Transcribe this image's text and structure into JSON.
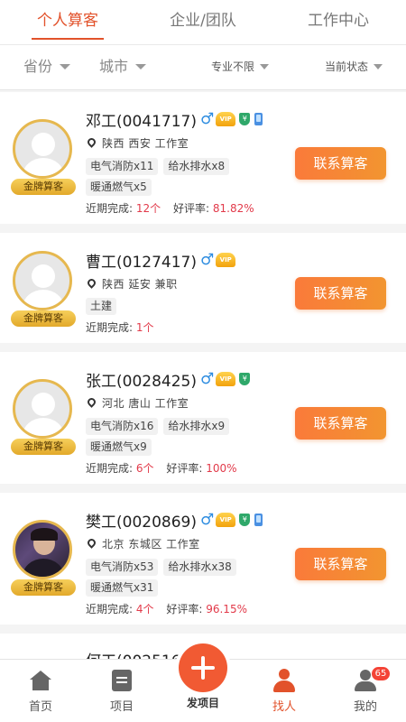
{
  "tabs": [
    {
      "label": "个人算客",
      "active": true
    },
    {
      "label": "企业/团队",
      "active": false
    },
    {
      "label": "工作中心",
      "active": false
    }
  ],
  "filters": {
    "province": "省份",
    "city": "城市",
    "specialty": "专业不限",
    "status": "当前状态"
  },
  "card_common": {
    "badge": "金牌算客",
    "contact": "联系算客",
    "recent_label": "近期完成:",
    "rating_label": "好评率:",
    "male_symbol": "♂",
    "vip_text": "VIP",
    "shield_text": "¥"
  },
  "workers": [
    {
      "name": "邓工(0041717)",
      "location": "陕西 西安 工作室",
      "tags": [
        "电气消防x11",
        "给水排水x8",
        "暖通燃气x5"
      ],
      "recent": "12个",
      "rating": "81.82%",
      "icons": [
        "male-icon",
        "vip-icon",
        "shield-icon",
        "phone-icon"
      ]
    },
    {
      "name": "曹工(0127417)",
      "location": "陕西 延安 兼职",
      "tags": [
        "土建"
      ],
      "recent": "1个",
      "icons": [
        "male-icon",
        "vip-icon"
      ]
    },
    {
      "name": "张工(0028425)",
      "location": "河北 唐山 工作室",
      "tags": [
        "电气消防x16",
        "给水排水x9",
        "暖通燃气x9"
      ],
      "recent": "6个",
      "rating": "100%",
      "icons": [
        "male-icon",
        "vip-icon",
        "shield-icon"
      ]
    },
    {
      "name": "樊工(0020869)",
      "location": "北京 东城区 工作室",
      "tags": [
        "电气消防x53",
        "给水排水x38",
        "暖通燃气x31"
      ],
      "recent": "4个",
      "rating": "96.15%",
      "icons": [
        "male-icon",
        "vip-icon",
        "shield-icon",
        "phone-icon"
      ]
    },
    {
      "name": "何工(002516"
    }
  ],
  "bottom_nav": [
    {
      "label": "首页",
      "icon": "home-icon"
    },
    {
      "label": "项目",
      "icon": "project-icon"
    },
    {
      "label": "发项目",
      "icon": "plus-icon"
    },
    {
      "label": "找人",
      "icon": "find-person-icon",
      "active": true
    },
    {
      "label": "我的",
      "icon": "profile-icon",
      "badge": "65"
    }
  ],
  "colors": {
    "accent": "#e2522b",
    "button": "#f58a35",
    "gold": "#e6b84f",
    "number": "#e23a4a"
  }
}
